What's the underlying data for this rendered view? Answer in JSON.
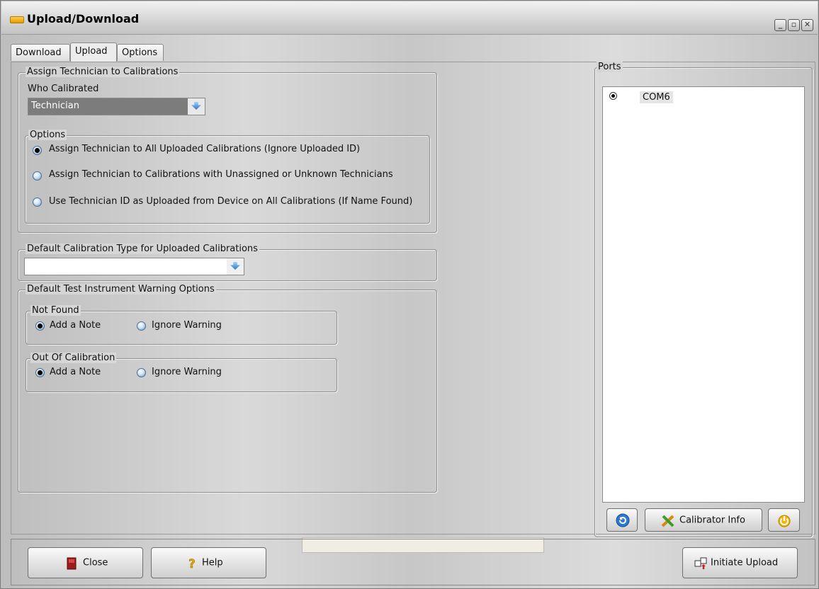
{
  "window": {
    "title": "Upload/Download"
  },
  "tabs": [
    {
      "label": "Download"
    },
    {
      "label": "Upload"
    },
    {
      "label": "Options"
    }
  ],
  "technician": {
    "group_label": "Assign Technician to Calibrations",
    "who_label": "Who Calibrated",
    "who_value": "Technician",
    "options_label": "Options",
    "options": [
      {
        "label": "Assign Technician to All Uploaded Calibrations (Ignore Uploaded ID)",
        "selected": true
      },
      {
        "label": "Assign Technician to Calibrations with Unassigned or Unknown Technicians",
        "selected": false
      },
      {
        "label": "Use Technician ID as Uploaded from Device on All Calibrations (If Name Found)",
        "selected": false
      }
    ]
  },
  "calibration_type": {
    "label": "Default Calibration Type for Uploaded Calibrations",
    "value": ""
  },
  "warnings": {
    "label": "Default Test Instrument Warning Options",
    "not_found": {
      "label": "Not Found",
      "add_note": "Add a Note",
      "ignore": "Ignore Warning",
      "selected": "add_note"
    },
    "out_of_cal": {
      "label": "Out Of Calibration",
      "add_note": "Add a Note",
      "ignore": "Ignore Warning",
      "selected": "add_note"
    }
  },
  "ports": {
    "label": "Ports",
    "items": [
      {
        "label": "COM6",
        "selected": true
      }
    ],
    "calibrator_info_label": "Calibrator Info"
  },
  "footer": {
    "close_label": "Close",
    "help_label": "Help",
    "initiate_label": "Initiate Upload"
  },
  "colors": {
    "accent_blue": "#2a76c8",
    "combo_dark": "#7c7c7c"
  }
}
